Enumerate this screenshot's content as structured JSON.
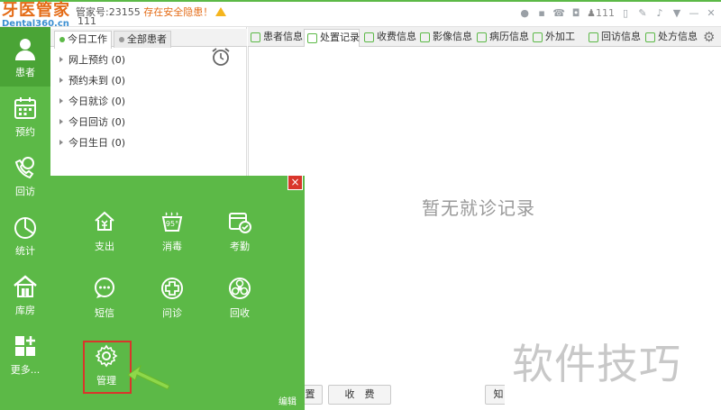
{
  "app": {
    "logo_cn": "牙医管家",
    "logo_en": "Dental360.cn",
    "account": "管家号:23155",
    "warning": "存在安全隐患！",
    "account_sub": "111",
    "user_count": "111"
  },
  "leftnav": [
    {
      "label": "患者",
      "icon": "patient-icon"
    },
    {
      "label": "预约",
      "icon": "calendar-icon"
    },
    {
      "label": "回访",
      "icon": "phone-call-icon"
    },
    {
      "label": "统计",
      "icon": "pie-chart-icon"
    },
    {
      "label": "库房",
      "icon": "warehouse-icon"
    },
    {
      "label": "更多...",
      "icon": "more-grid-icon"
    }
  ],
  "patient_panel": {
    "tabs": [
      "今日工作",
      "全部患者"
    ],
    "items": [
      "网上预约 (0)",
      "预约未到 (0)",
      "今日就诊 (0)",
      "今日回访 (0)",
      "今日生日 (0)"
    ]
  },
  "record_tabs": [
    "患者信息",
    "处置记录",
    "收费信息",
    "影像信息",
    "病历信息",
    "外加工",
    "回访信息",
    "处方信息"
  ],
  "empty_message": "暂无就诊记录",
  "bottom_buttons": [
    "置",
    "收　费",
    "知"
  ],
  "watermark": "软件技巧",
  "popup": {
    "items": [
      {
        "label": "支出",
        "icon": "expense-icon"
      },
      {
        "label": "消毒",
        "icon": "disinfect-icon"
      },
      {
        "label": "考勤",
        "icon": "attendance-icon"
      },
      {
        "label": "短信",
        "icon": "sms-icon"
      },
      {
        "label": "问诊",
        "icon": "consult-icon"
      },
      {
        "label": "回收",
        "icon": "biohazard-icon"
      },
      {
        "label": "管理",
        "icon": "settings-icon"
      }
    ],
    "edit": "编辑",
    "close": "×"
  },
  "colors": {
    "brand_green": "#5cb947",
    "logo_orange": "#e46b16",
    "highlight_red": "#d9362b"
  }
}
